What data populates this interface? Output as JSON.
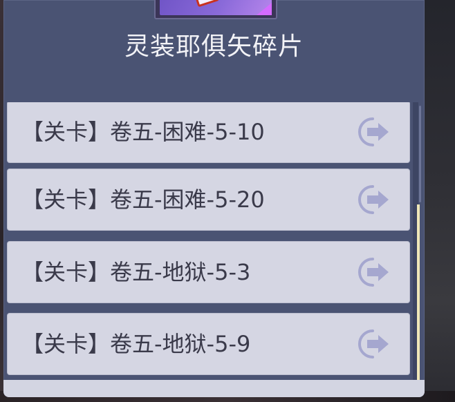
{
  "item": {
    "name": "灵装耶俱矢碎片",
    "icon": "item-fragment-icon"
  },
  "sources": [
    {
      "label": "【关卡】卷五-困难-5-10",
      "action_icon": "goto-arrow-icon"
    },
    {
      "label": "【关卡】卷五-困难-5-20",
      "action_icon": "goto-arrow-icon"
    },
    {
      "label": "【关卡】卷五-地狱-5-3",
      "action_icon": "goto-arrow-icon"
    },
    {
      "label": "【关卡】卷五-地狱-5-9",
      "action_icon": "goto-arrow-icon"
    }
  ],
  "colors": {
    "panel": "#4a5373",
    "row": "#d5d6e3",
    "row_text": "#3a3a4a",
    "go_icon": "#a5a7cf",
    "title": "#f2f2f6"
  }
}
